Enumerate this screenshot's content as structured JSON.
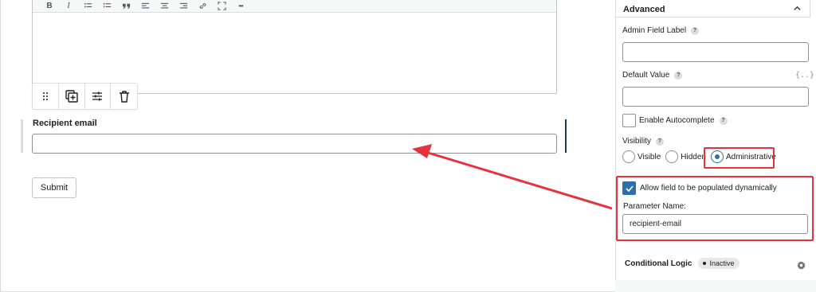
{
  "editor": {
    "toolbar_buttons": [
      "bold",
      "italic",
      "bullet-list",
      "numbered-list",
      "blockquote",
      "align-left",
      "align-center",
      "align-right",
      "link",
      "fullscreen",
      "more"
    ],
    "bold_label": "B",
    "italic_label": "I",
    "more_label": "•••"
  },
  "block_toolbar": {
    "buttons": [
      "drag",
      "duplicate",
      "settings",
      "delete"
    ]
  },
  "field": {
    "label": "Recipient email",
    "value": ""
  },
  "form": {
    "submit_label": "Submit"
  },
  "sidebar": {
    "panel_title": "Advanced",
    "admin_label": "Admin Field Label",
    "admin_value": "",
    "default_label": "Default Value",
    "default_value": "",
    "merge_tag": "{..}",
    "help_glyph": "?",
    "autocomplete_label": "Enable Autocomplete",
    "autocomplete_checked": false,
    "visibility_label": "Visibility",
    "visibility_options": [
      "Visible",
      "Hidden",
      "Administrative"
    ],
    "visibility_selected": "Administrative",
    "dynamic_label": "Allow field to be populated dynamically",
    "dynamic_checked": true,
    "param_label": "Parameter Name:",
    "param_value": "recipient-email",
    "conditional_label": "Conditional Logic",
    "conditional_status": "Inactive"
  },
  "colors": {
    "highlight": "#e4323f",
    "accent": "#2d6fa8"
  }
}
